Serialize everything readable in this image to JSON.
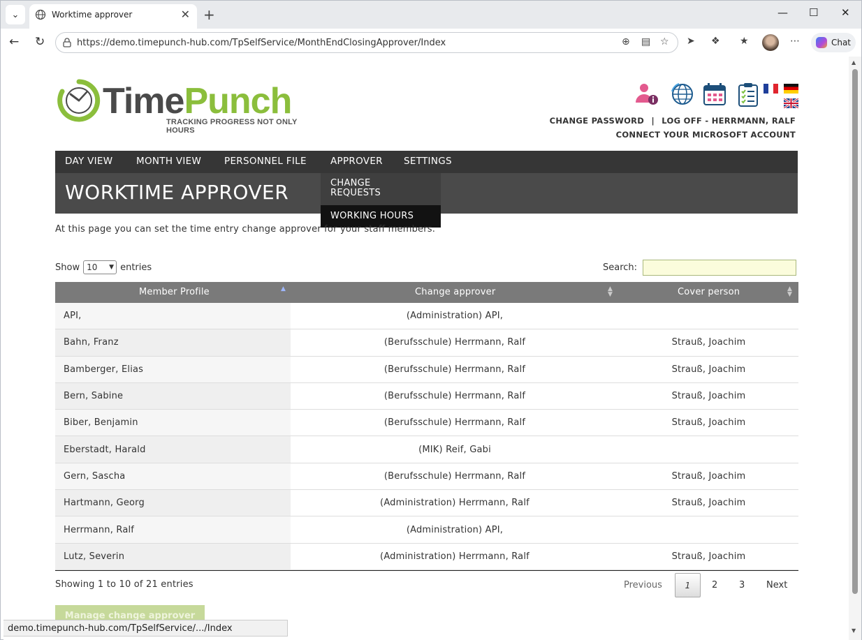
{
  "browser": {
    "tab_title": "Worktime approver",
    "url": "https://demo.timepunch-hub.com/TpSelfService/MonthEndClosingApprover/Index",
    "chat_label": "Chat",
    "status_url": "demo.timepunch-hub.com/TpSelfService/.../Index"
  },
  "logo": {
    "name_part1": "Time",
    "name_part2": "Punch",
    "tagline": "TRACKING PROGRESS NOT ONLY HOURS",
    "brand_green": "#8bbe3c"
  },
  "header": {
    "change_password": "CHANGE PASSWORD",
    "separator": "|",
    "log_off": "LOG OFF - HERRMANN, RALF",
    "connect_ms": "CONNECT YOUR MICROSOFT ACCOUNT"
  },
  "nav": {
    "items": [
      "DAY VIEW",
      "MONTH VIEW",
      "PERSONNEL FILE",
      "APPROVER",
      "SETTINGS"
    ]
  },
  "dropdown": {
    "item1": "CHANGE REQUESTS",
    "item2": "WORKING HOURS"
  },
  "page": {
    "title": "WORKTIME APPROVER",
    "intro": "At this page you can set the time entry change approver for your staff members."
  },
  "table_controls": {
    "show_label": "Show",
    "show_value": "10",
    "entries_label": "entries",
    "search_label": "Search:"
  },
  "table": {
    "columns": [
      "Member Profile",
      "Change approver",
      "Cover person"
    ],
    "rows": [
      {
        "member": "API,",
        "approver": "(Administration) API,",
        "cover": ""
      },
      {
        "member": "Bahn, Franz",
        "approver": "(Berufsschule) Herrmann, Ralf",
        "cover": "Strauß, Joachim"
      },
      {
        "member": "Bamberger, Elias",
        "approver": "(Berufsschule) Herrmann, Ralf",
        "cover": "Strauß, Joachim"
      },
      {
        "member": "Bern, Sabine",
        "approver": "(Berufsschule) Herrmann, Ralf",
        "cover": "Strauß, Joachim"
      },
      {
        "member": "Biber, Benjamin",
        "approver": "(Berufsschule) Herrmann, Ralf",
        "cover": "Strauß, Joachim"
      },
      {
        "member": "Eberstadt, Harald",
        "approver": "(MIK) Reif, Gabi",
        "cover": ""
      },
      {
        "member": "Gern, Sascha",
        "approver": "(Berufsschule) Herrmann, Ralf",
        "cover": "Strauß, Joachim"
      },
      {
        "member": "Hartmann, Georg",
        "approver": "(Administration) Herrmann, Ralf",
        "cover": "Strauß, Joachim"
      },
      {
        "member": "Herrmann, Ralf",
        "approver": "(Administration) API,",
        "cover": ""
      },
      {
        "member": "Lutz, Severin",
        "approver": "(Administration) Herrmann, Ralf",
        "cover": "Strauß, Joachim"
      }
    ]
  },
  "pagination": {
    "info": "Showing 1 to 10 of 21 entries",
    "previous": "Previous",
    "pages": [
      "1",
      "2",
      "3"
    ],
    "next": "Next"
  },
  "actions": {
    "manage": "Manage change approver"
  }
}
